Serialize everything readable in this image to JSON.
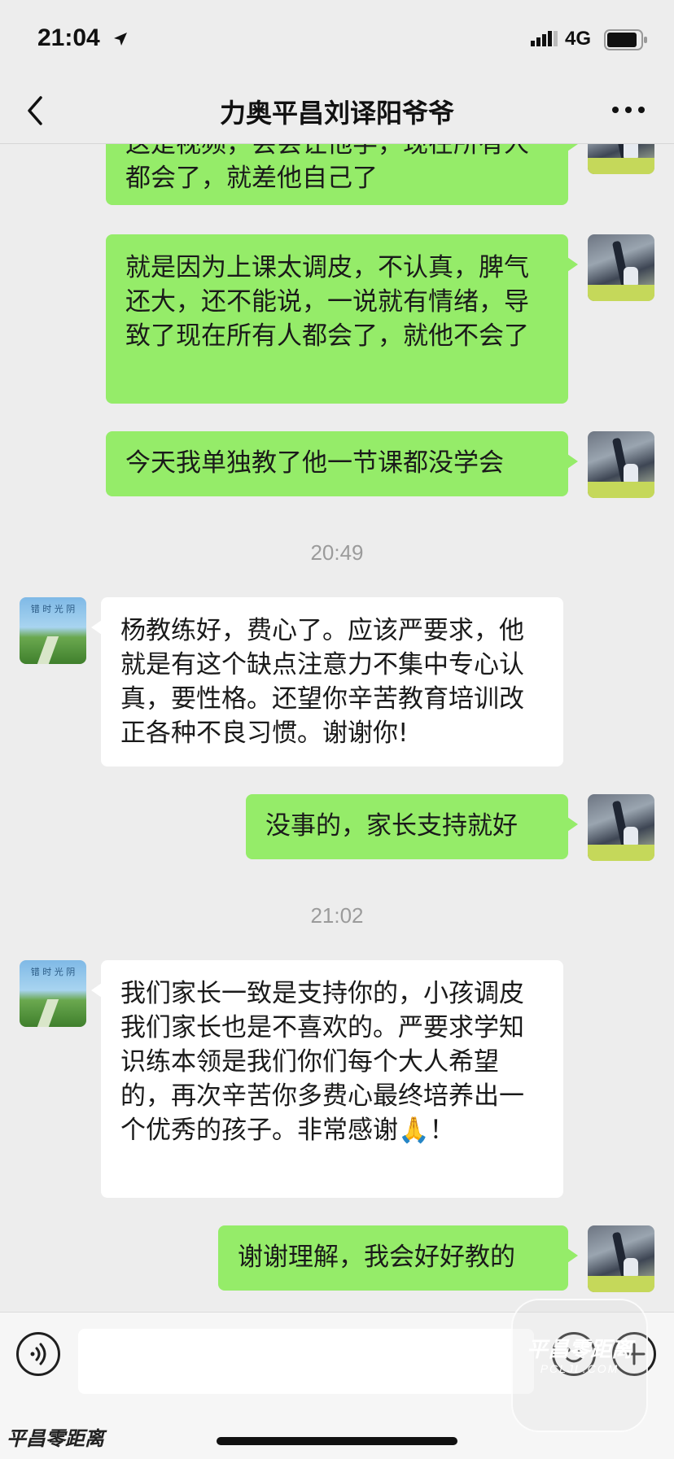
{
  "status_bar": {
    "time": "21:04",
    "network": "4G"
  },
  "header": {
    "title": "力奥平昌刘译阳爷爷"
  },
  "messages": [
    {
      "from": "self",
      "text": "这是视频，会会让他学，现在所有人都会了，就差他自己了"
    },
    {
      "from": "self",
      "text": "就是因为上课太调皮，不认真，脾气还大，还不能说，一说就有情绪，导致了现在所有人都会了，就他不会了"
    },
    {
      "from": "self",
      "text": "今天我单独教了他一节课都没学会"
    },
    {
      "from": "time",
      "text": "20:49"
    },
    {
      "from": "other",
      "text": "杨教练好，费心了。应该严要求，他就是有这个缺点注意力不集中专心认真，要性格。还望你辛苦教育培训改正各种不良习惯。谢谢你!"
    },
    {
      "from": "self",
      "text": "没事的，家长支持就好"
    },
    {
      "from": "time",
      "text": "21:02"
    },
    {
      "from": "other",
      "text": "我们家长一致是支持你的，小孩调皮我们家长也是不喜欢的。严要求学知识练本领是我们你们每个大人希望的，再次辛苦你多费心最终培养出一个优秀的孩子。非常感谢🙏！"
    },
    {
      "from": "self",
      "text": "谢谢理解，我会好好教的"
    }
  ],
  "avatar_parent_caption": "错 时 光 阴",
  "input": {
    "placeholder": ""
  },
  "watermark": {
    "left": "平昌零距离",
    "right_title": "平昌零距离",
    "right_sub": "PCLJL.COM"
  },
  "colors": {
    "outgoing_bubble": "#95ec69",
    "incoming_bubble": "#ffffff",
    "background": "#ededed"
  }
}
